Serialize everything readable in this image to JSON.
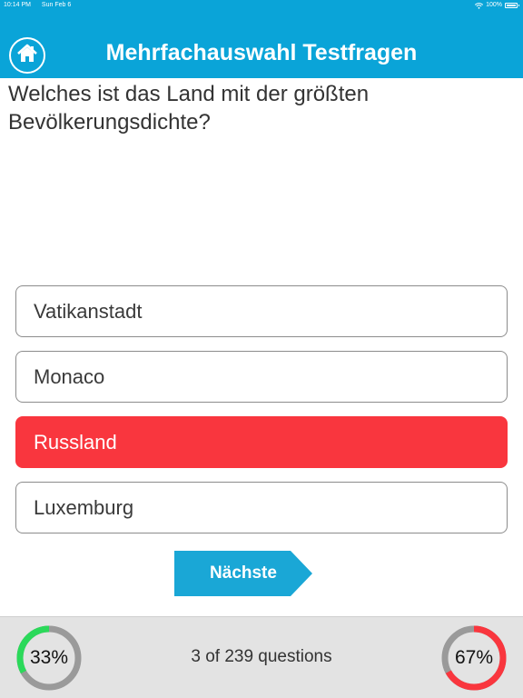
{
  "status_bar": {
    "time": "10:14 PM",
    "date": "Sun Feb 6",
    "battery": "100%"
  },
  "header": {
    "title": "Mehrfachauswahl Testfragen",
    "home_icon": "home-icon"
  },
  "question": {
    "text": "Welches ist das Land mit der größten Bevölkerungsdichte?"
  },
  "options": [
    {
      "label": "Vatikanstadt",
      "state": "default"
    },
    {
      "label": "Monaco",
      "state": "default"
    },
    {
      "label": "Russland",
      "state": "selected-wrong"
    },
    {
      "label": "Luxemburg",
      "state": "default"
    }
  ],
  "next_button": {
    "label": "Nächste"
  },
  "footer": {
    "progress_text": "3 of 239 questions",
    "correct_gauge": {
      "label": "33%",
      "value": 0.33
    },
    "wrong_gauge": {
      "label": "67%",
      "value": 0.67
    }
  },
  "colors": {
    "header": "#0aa4d8",
    "next_button": "#1aa7d6",
    "wrong": "#f9363e",
    "correct": "#2bd95a",
    "gauge_track": "#9a9a9a"
  }
}
